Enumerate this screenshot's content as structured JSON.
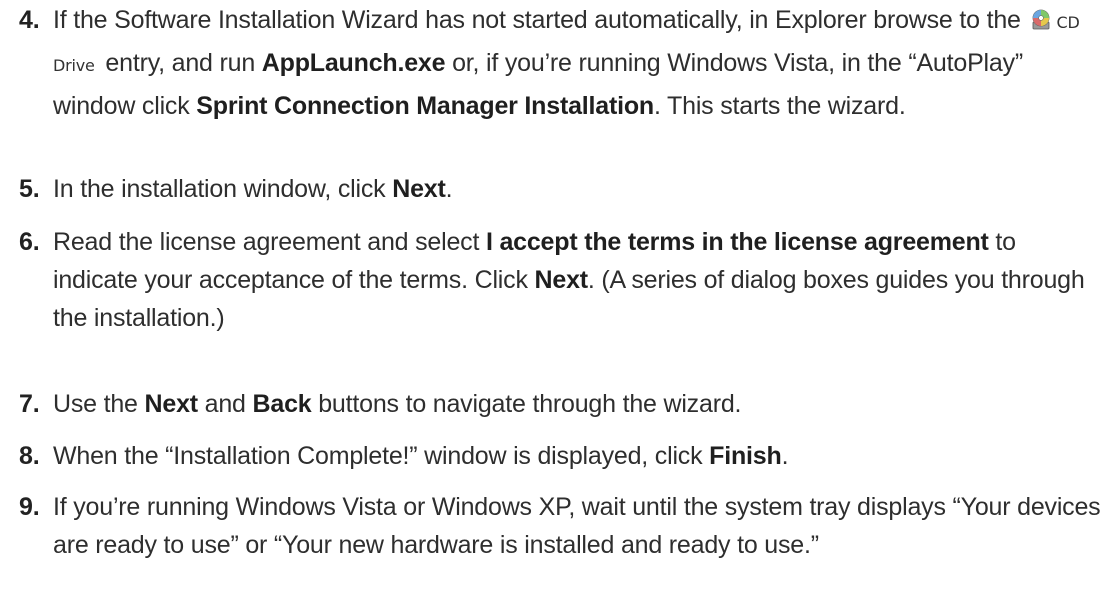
{
  "steps": [
    {
      "number": "4.",
      "segments": [
        {
          "text": "If the Software Installation Wizard has not started automatically, in Explorer browse to the ",
          "bold": false
        },
        {
          "icon": "cd-drive-icon",
          "label": "CD Drive"
        },
        {
          "text": " entry, and run ",
          "bold": false
        },
        {
          "text": "AppLaunch.exe",
          "bold": true
        },
        {
          "text": " or, if you’re running Windows Vista, in the “AutoPlay” window click ",
          "bold": false
        },
        {
          "text": "Sprint Connection Manager Installation",
          "bold": true
        },
        {
          "text": ". This starts the wizard.",
          "bold": false
        }
      ]
    },
    {
      "number": "5.",
      "segments": [
        {
          "text": "In the installation window, click ",
          "bold": false
        },
        {
          "text": "Next",
          "bold": true
        },
        {
          "text": ".",
          "bold": false
        }
      ]
    },
    {
      "number": "6.",
      "segments": [
        {
          "text": "Read the license agreement and select ",
          "bold": false
        },
        {
          "text": "I accept the terms in the license agreement",
          "bold": true
        },
        {
          "text": " to indicate your acceptance of the terms. Click ",
          "bold": false
        },
        {
          "text": "Next",
          "bold": true
        },
        {
          "text": ". (A series of dialog boxes guides you through the installation.)",
          "bold": false
        }
      ]
    },
    {
      "number": "7.",
      "segments": [
        {
          "text": "Use the ",
          "bold": false
        },
        {
          "text": "Next",
          "bold": true
        },
        {
          "text": " and ",
          "bold": false
        },
        {
          "text": "Back",
          "bold": true
        },
        {
          "text": " buttons to navigate through the wizard.",
          "bold": false
        }
      ]
    },
    {
      "number": "8.",
      "segments": [
        {
          "text": "When the “Installation Complete!” window is displayed, click ",
          "bold": false
        },
        {
          "text": "Finish",
          "bold": true
        },
        {
          "text": ".",
          "bold": false
        }
      ]
    },
    {
      "number": "9.",
      "segments": [
        {
          "text": "If you’re running Windows Vista or Windows XP, wait until the system tray displays “Your devices are ready to use” or “Your new hardware is installed and ready to use.”",
          "bold": false
        }
      ]
    }
  ]
}
